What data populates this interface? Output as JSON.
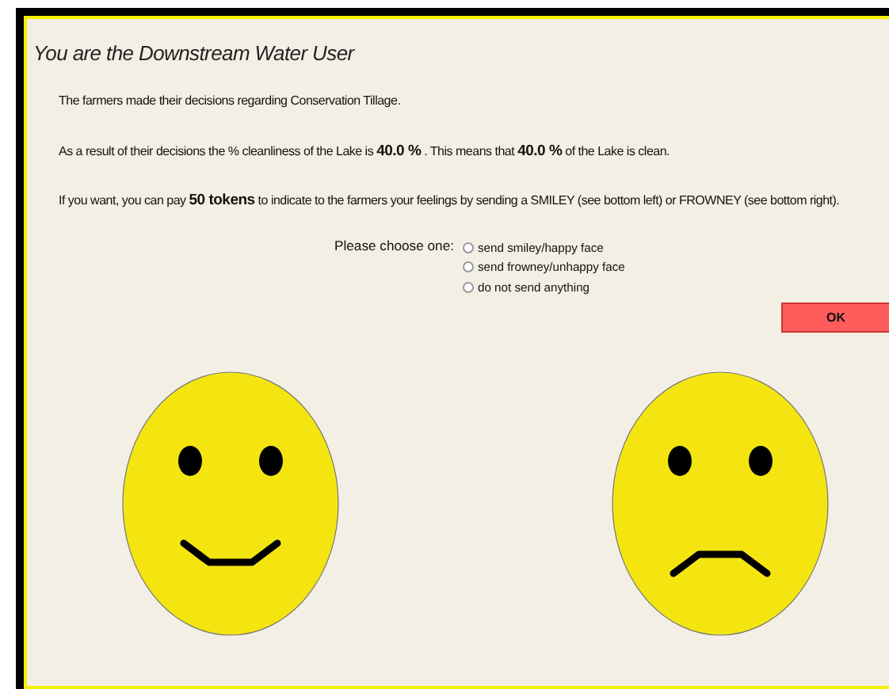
{
  "title": "You are the Downstream Water User",
  "paragraphs": [
    "The farmers made their decisions regarding Conservation Tillage.",
    "As a result of their decisions the % cleanliness of the Lake is **40.0 %** . This means that **40.0 %** of the Lake is clean.",
    "If you want, you can pay **50 tokens** to indicate to the farmers your feelings by sending a SMILEY (see bottom left) or FROWNEY (see bottom right)."
  ],
  "choice": {
    "label": "Please choose one:",
    "options": [
      {
        "label": "send smiley/happy face",
        "selected": false
      },
      {
        "label": "send frowney/unhappy face",
        "selected": false
      },
      {
        "label": "do not send anything",
        "selected": false
      }
    ]
  },
  "ok_button": "OK",
  "faces": [
    {
      "kind": "happy"
    },
    {
      "kind": "sad"
    }
  ]
}
